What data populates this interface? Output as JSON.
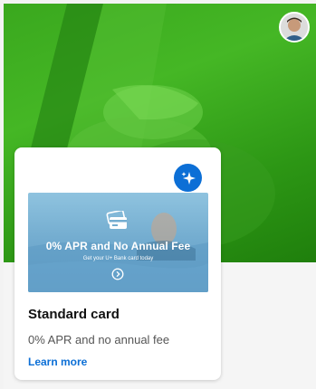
{
  "hero": {
    "image": "hand-holding-phone-green"
  },
  "avatar": {
    "icon": "user-avatar"
  },
  "card": {
    "badge_icon": "sparkle-icon",
    "banner": {
      "title": "0% APR and No Annual Fee",
      "subtitle": "Get your U+ Bank card today",
      "icon": "credit-card-icon",
      "action_icon": "chevron-right-circle-icon"
    },
    "title": "Standard card",
    "description": "0% APR and no annual fee",
    "link": "Learn more"
  },
  "colors": {
    "accent": "#0c6fd6",
    "hero_green": "#3aa81e"
  }
}
